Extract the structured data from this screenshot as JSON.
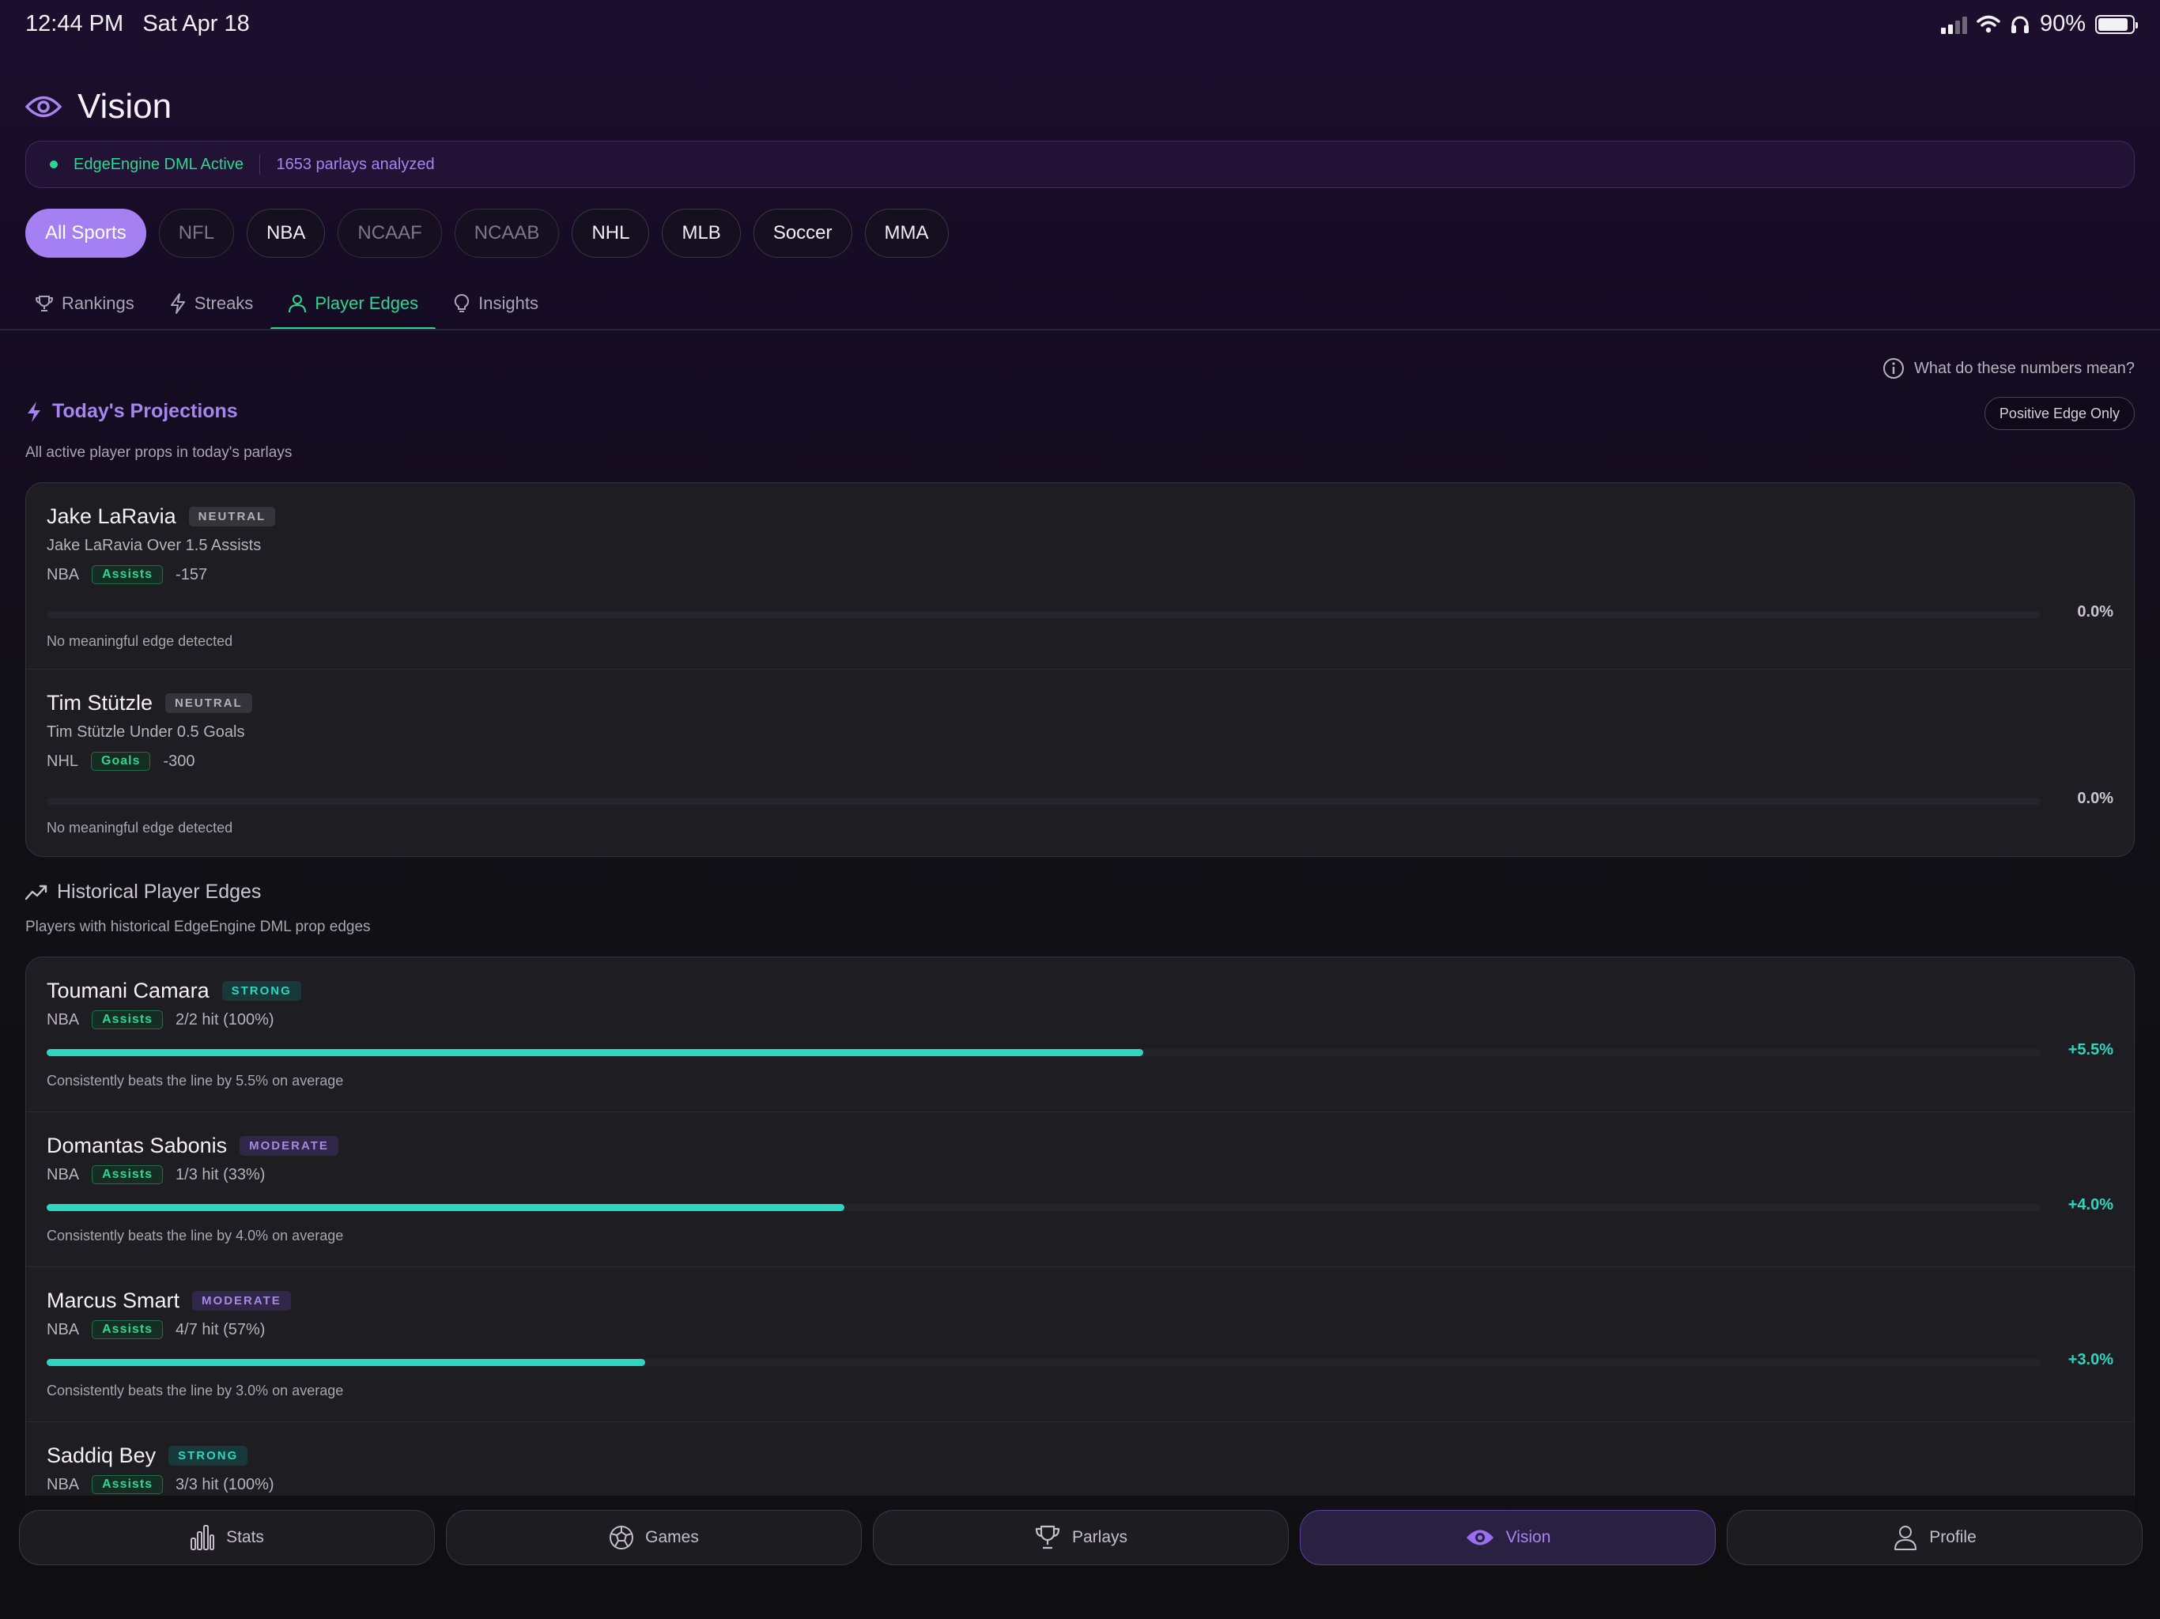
{
  "status_bar": {
    "time": "12:44 PM",
    "date": "Sat Apr 18",
    "battery": "90%"
  },
  "header": {
    "title": "Vision",
    "icon": "eye-icon"
  },
  "engine": {
    "status": "EdgeEngine DML Active",
    "count": "1653 parlays analyzed"
  },
  "sports": [
    {
      "label": "All Sports",
      "state": "active"
    },
    {
      "label": "NFL",
      "state": "dim"
    },
    {
      "label": "NBA",
      "state": "normal"
    },
    {
      "label": "NCAAF",
      "state": "dim"
    },
    {
      "label": "NCAAB",
      "state": "dim"
    },
    {
      "label": "NHL",
      "state": "normal"
    },
    {
      "label": "MLB",
      "state": "normal"
    },
    {
      "label": "Soccer",
      "state": "normal"
    },
    {
      "label": "MMA",
      "state": "normal"
    }
  ],
  "tabs": [
    {
      "label": "Rankings",
      "icon": "trophy-icon"
    },
    {
      "label": "Streaks",
      "icon": "lightning-icon"
    },
    {
      "label": "Player Edges",
      "icon": "person-icon",
      "active": true
    },
    {
      "label": "Insights",
      "icon": "lightbulb-icon"
    }
  ],
  "help_link": "What do these numbers mean?",
  "positive_toggle": "Positive Edge Only",
  "today": {
    "title": "Today's Projections",
    "subtitle": "All active player props in today's parlays",
    "items": [
      {
        "name": "Jake LaRavia",
        "badge": "NEUTRAL",
        "prop": "Jake LaRavia Over 1.5 Assists",
        "league": "NBA",
        "tag": "Assists",
        "odds": "-157",
        "edge": "0.0%",
        "edge_fraction": 0,
        "note": "No meaningful edge detected"
      },
      {
        "name": "Tim Stützle",
        "badge": "NEUTRAL",
        "prop": "Tim Stützle Under 0.5 Goals",
        "league": "NHL",
        "tag": "Goals",
        "odds": "-300",
        "edge": "0.0%",
        "edge_fraction": 0,
        "note": "No meaningful edge detected"
      }
    ]
  },
  "historical": {
    "title": "Historical Player Edges",
    "subtitle": "Players with historical EdgeEngine DML prop edges",
    "items": [
      {
        "name": "Toumani Camara",
        "badge": "STRONG",
        "league": "NBA",
        "tag": "Assists",
        "hit": "2/2 hit (100%)",
        "edge": "+5.5%",
        "edge_fraction": 0.55,
        "note": "Consistently beats the line by 5.5% on average"
      },
      {
        "name": "Domantas Sabonis",
        "badge": "MODERATE",
        "league": "NBA",
        "tag": "Assists",
        "hit": "1/3 hit (33%)",
        "edge": "+4.0%",
        "edge_fraction": 0.4,
        "note": "Consistently beats the line by 4.0% on average"
      },
      {
        "name": "Marcus Smart",
        "badge": "MODERATE",
        "league": "NBA",
        "tag": "Assists",
        "hit": "4/7 hit (57%)",
        "edge": "+3.0%",
        "edge_fraction": 0.3,
        "note": "Consistently beats the line by 3.0% on average"
      },
      {
        "name": "Saddiq Bey",
        "badge": "STRONG",
        "league": "NBA",
        "tag": "Assists",
        "hit": "3/3 hit (100%)"
      }
    ]
  },
  "nav": [
    {
      "label": "Stats",
      "icon": "stats-icon"
    },
    {
      "label": "Games",
      "icon": "soccer-ball-icon"
    },
    {
      "label": "Parlays",
      "icon": "trophy-icon"
    },
    {
      "label": "Vision",
      "icon": "eye-icon",
      "active": true
    },
    {
      "label": "Profile",
      "icon": "person-icon"
    }
  ],
  "colors": {
    "accent_purple": "#a580f2",
    "accent_green": "#2fd692",
    "accent_teal": "#2fd6bf"
  }
}
